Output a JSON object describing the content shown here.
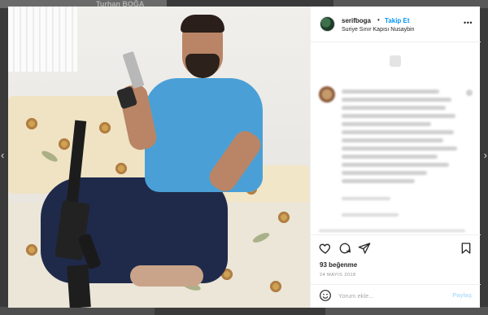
{
  "background": {
    "watermark": "Turhan BOĞA"
  },
  "post": {
    "username": "serifboga",
    "separator": "•",
    "follow_label": "Takip Et",
    "location": "Suriye Sınır Kapısı Nusaybin",
    "more_glyph": "•••",
    "likes": "93 beğenme",
    "date": "24 MAYIS 2018",
    "comment_placeholder": "Yorum ekle...",
    "share_label": "Paylaş"
  },
  "icons": {
    "heart": "heart-icon",
    "comment": "comment-icon",
    "share": "send-icon",
    "save": "bookmark-icon",
    "emoji": "emoji-icon",
    "more": "more-options-icon"
  },
  "colors": {
    "accent": "#0095f6",
    "text": "#262626",
    "muted": "#8e8e8e",
    "share_disabled": "#b2dffc"
  }
}
